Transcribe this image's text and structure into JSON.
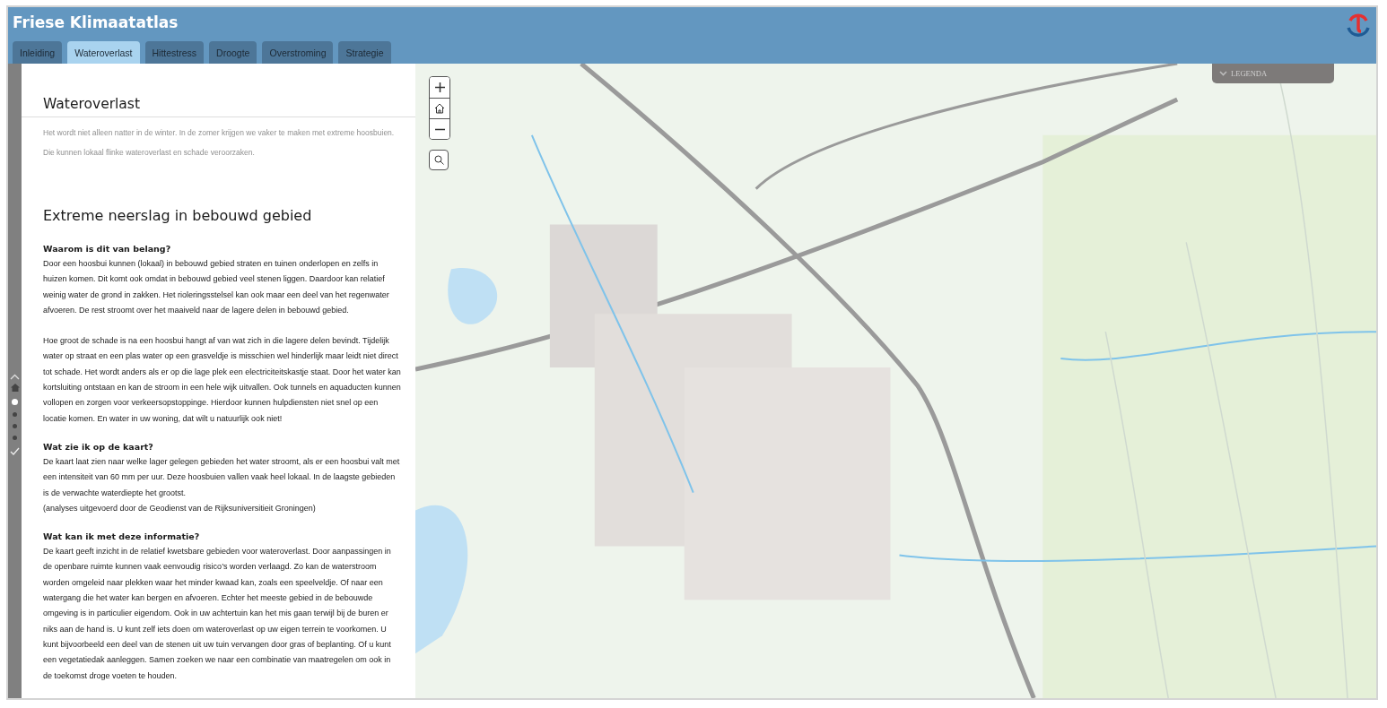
{
  "app": {
    "title": "Friese Klimaatatlas"
  },
  "tabs": [
    {
      "label": "Inleiding",
      "selected": false
    },
    {
      "label": "Wateroverlast",
      "selected": true
    },
    {
      "label": "Hittestress",
      "selected": false
    },
    {
      "label": "Droogte",
      "selected": false
    },
    {
      "label": "Overstroming",
      "selected": false
    },
    {
      "label": "Strategie",
      "selected": false
    }
  ],
  "story_nav": {
    "steps": [
      {
        "selected": true
      },
      {
        "selected": false
      },
      {
        "selected": false
      },
      {
        "selected": false
      }
    ]
  },
  "panel": {
    "title": "Wateroverlast",
    "intro": "Het wordt niet alleen natter in de winter. In de zomer krijgen we vaker te maken met extreme hoosbuien. Die kunnen lokaal flinke wateroverlast en schade veroorzaken.",
    "heading": "Extreme neerslag in bebouwd gebied",
    "sections": [
      {
        "heading": "Waarom is dit van belang?",
        "paragraphs": [
          "Door een hoosbui kunnen (lokaal) in bebouwd gebied straten en tuinen onderlopen en zelfs in huizen komen. Dit komt ook omdat in bebouwd gebied veel stenen liggen. Daardoor kan relatief weinig water de grond in zakken. Het rioleringsstelsel kan ook maar een deel van het regenwater afvoeren. De rest stroomt over het maaiveld naar de lagere delen in bebouwd gebied.",
          "Hoe groot de schade is na een hoosbui hangt af van wat zich in die lagere delen bevindt. Tijdelijk water op straat en een plas water op een grasveldje is misschien wel hinderlijk maar leidt niet direct tot schade. Het wordt anders als er op die lage plek een electriciteitskastje staat. Door het water kan kortsluiting ontstaan en kan de stroom in een hele wijk uitvallen. Ook tunnels en aquaducten kunnen vollopen en zorgen voor verkeersopstoppinge. Hierdoor kunnen hulpdiensten niet snel op een locatie komen. En water in uw woning, dat wilt u natuurlijk ook niet!"
        ]
      },
      {
        "heading": "Wat zie ik op de kaart?",
        "paragraphs": [
          "De kaart laat zien naar welke lager gelegen gebieden het water stroomt, als er een hoosbui valt met een intensiteit van 60 mm per uur. Deze hoosbuien vallen vaak heel lokaal. In de laagste gebieden is de verwachte waterdiepte het grootst."
        ],
        "note": "(analyses uitgevoerd door de Geodienst van de Rijksuniversitieit Groningen)"
      },
      {
        "heading": "Wat kan ik met deze informatie?",
        "paragraphs": [
          "De kaart geeft inzicht in de relatief kwetsbare gebieden voor wateroverlast. Door aanpassingen in de openbare ruimte kunnen vaak eenvoudig risico’s worden verlaagd. Zo kan de waterstroom worden omgeleid naar plekken waar het minder kwaad kan, zoals een speelveldje. Of naar een watergang die het water kan bergen en afvoeren. Echter het meeste gebied in de bebouwde omgeving is in particulier eigendom. Ook in uw achtertuin kan het mis gaan terwijl bij de buren er niks aan de hand is. U kunt zelf iets doen om wateroverlast op uw eigen terrein te voorkomen. U kunt bijvoorbeeld een deel van de stenen uit uw tuin vervangen door gras of beplanting. Of u kunt een vegetatiedak aanleggen. Samen zoeken we naar een combinatie van maatregelen om ook in de toekomst droge voeten te houden."
        ]
      }
    ]
  },
  "map": {
    "legend": {
      "label": "LEGENDA"
    }
  }
}
